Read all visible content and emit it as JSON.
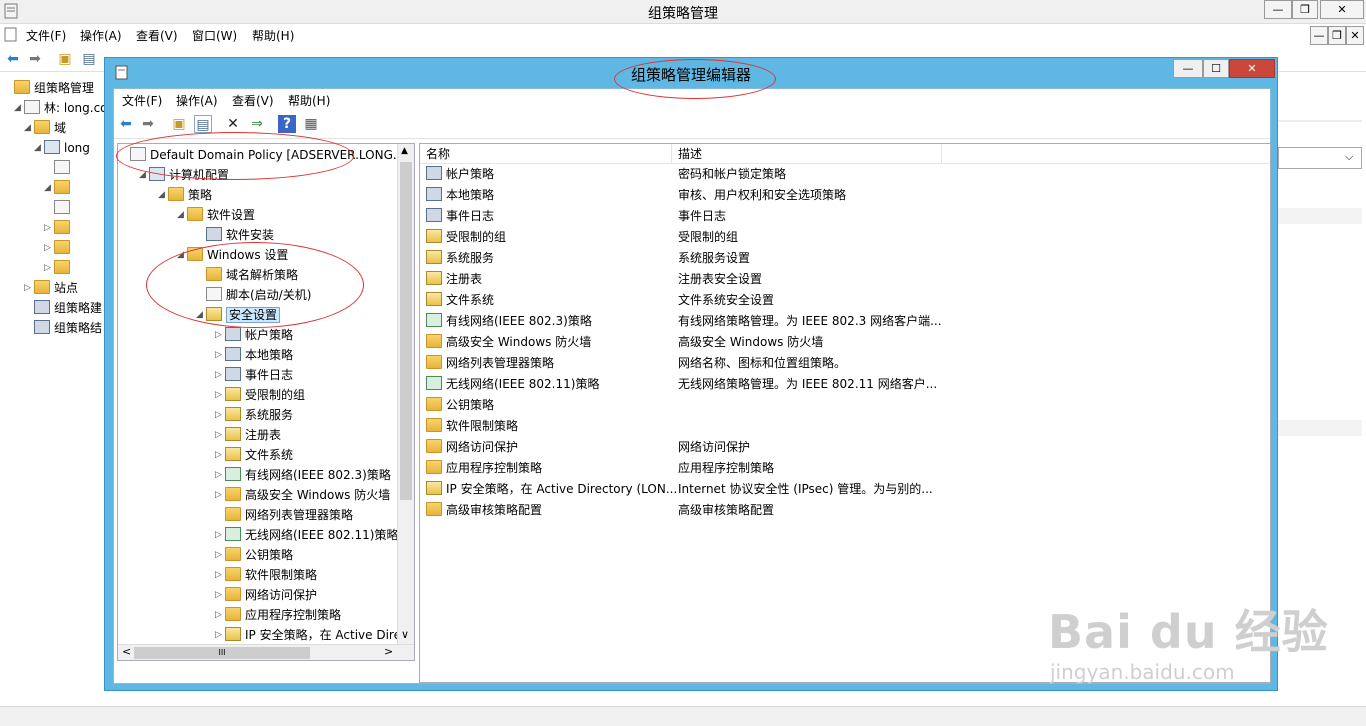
{
  "outer": {
    "title": "组策略管理",
    "win_buttons": {
      "minimize": "—",
      "restore": "❐",
      "close": "✕"
    },
    "menu": [
      "文件(F)",
      "操作(A)",
      "查看(V)",
      "窗口(W)",
      "帮助(H)"
    ],
    "tree": [
      {
        "label": "组策略管理",
        "indent": 0,
        "expander": ""
      },
      {
        "label": "林: long.co",
        "indent": 1,
        "expander": "◢"
      },
      {
        "label": "域",
        "indent": 2,
        "expander": "◢"
      },
      {
        "label": "long",
        "indent": 3,
        "expander": "◢"
      },
      {
        "label": "",
        "indent": 4,
        "expander": ""
      },
      {
        "label": "",
        "indent": 4,
        "expander": "◢"
      },
      {
        "label": "",
        "indent": 4,
        "expander": ""
      },
      {
        "label": "",
        "indent": 4,
        "expander": "▷"
      },
      {
        "label": "",
        "indent": 4,
        "expander": "▷"
      },
      {
        "label": "",
        "indent": 4,
        "expander": "▷"
      },
      {
        "label": "站点",
        "indent": 2,
        "expander": "▷"
      },
      {
        "label": "组策略建",
        "indent": 2,
        "expander": ""
      },
      {
        "label": "组策略结",
        "indent": 2,
        "expander": ""
      }
    ]
  },
  "editor": {
    "title": "组策略管理编辑器",
    "win_buttons": {
      "minimize": "—",
      "maximize": "☐",
      "close": "✕"
    },
    "menu": [
      "文件(F)",
      "操作(A)",
      "查看(V)",
      "帮助(H)"
    ],
    "tree": [
      {
        "label": "Default Domain Policy [ADSERVER.LONG.COI",
        "indent": 0,
        "expander": "",
        "icon": "doc"
      },
      {
        "label": "计算机配置",
        "indent": 1,
        "expander": "◢",
        "icon": "pc"
      },
      {
        "label": "策略",
        "indent": 2,
        "expander": "◢",
        "icon": "folder"
      },
      {
        "label": "软件设置",
        "indent": 3,
        "expander": "◢",
        "icon": "folder"
      },
      {
        "label": "软件安装",
        "indent": 4,
        "expander": "",
        "icon": "book"
      },
      {
        "label": "Windows 设置",
        "indent": 3,
        "expander": "◢",
        "icon": "folder"
      },
      {
        "label": "域名解析策略",
        "indent": 4,
        "expander": "",
        "icon": "folder"
      },
      {
        "label": "脚本(启动/关机)",
        "indent": 4,
        "expander": "",
        "icon": "doc"
      },
      {
        "label": "安全设置",
        "indent": 4,
        "expander": "◢",
        "icon": "shield",
        "selected": true
      },
      {
        "label": "帐户策略",
        "indent": 5,
        "expander": "▷",
        "icon": "book"
      },
      {
        "label": "本地策略",
        "indent": 5,
        "expander": "▷",
        "icon": "book"
      },
      {
        "label": "事件日志",
        "indent": 5,
        "expander": "▷",
        "icon": "book"
      },
      {
        "label": "受限制的组",
        "indent": 5,
        "expander": "▷",
        "icon": "shield"
      },
      {
        "label": "系统服务",
        "indent": 5,
        "expander": "▷",
        "icon": "shield"
      },
      {
        "label": "注册表",
        "indent": 5,
        "expander": "▷",
        "icon": "shield"
      },
      {
        "label": "文件系统",
        "indent": 5,
        "expander": "▷",
        "icon": "shield"
      },
      {
        "label": "有线网络(IEEE 802.3)策略",
        "indent": 5,
        "expander": "▷",
        "icon": "net"
      },
      {
        "label": "高级安全 Windows 防火墙",
        "indent": 5,
        "expander": "▷",
        "icon": "folder"
      },
      {
        "label": "网络列表管理器策略",
        "indent": 5,
        "expander": "",
        "icon": "folder"
      },
      {
        "label": "无线网络(IEEE 802.11)策略",
        "indent": 5,
        "expander": "▷",
        "icon": "net"
      },
      {
        "label": "公钥策略",
        "indent": 5,
        "expander": "▷",
        "icon": "folder"
      },
      {
        "label": "软件限制策略",
        "indent": 5,
        "expander": "▷",
        "icon": "folder"
      },
      {
        "label": "网络访问保护",
        "indent": 5,
        "expander": "▷",
        "icon": "folder"
      },
      {
        "label": "应用程序控制策略",
        "indent": 5,
        "expander": "▷",
        "icon": "folder"
      },
      {
        "label": "IP 安全策略，在 Active Direct",
        "indent": 5,
        "expander": "▷",
        "icon": "shield"
      }
    ],
    "scroll": {
      "up": "▲",
      "down": "∨",
      "left": "<",
      "right": ">",
      "grip": "III"
    },
    "list_columns": [
      "名称",
      "描述"
    ],
    "list_rows": [
      {
        "name": "帐户策略",
        "desc": "密码和帐户锁定策略",
        "icon": "book"
      },
      {
        "name": "本地策略",
        "desc": "审核、用户权利和安全选项策略",
        "icon": "book"
      },
      {
        "name": "事件日志",
        "desc": "事件日志",
        "icon": "book"
      },
      {
        "name": "受限制的组",
        "desc": "受限制的组",
        "icon": "shield"
      },
      {
        "name": "系统服务",
        "desc": "系统服务设置",
        "icon": "shield"
      },
      {
        "name": "注册表",
        "desc": "注册表安全设置",
        "icon": "shield"
      },
      {
        "name": "文件系统",
        "desc": "文件系统安全设置",
        "icon": "shield"
      },
      {
        "name": "有线网络(IEEE 802.3)策略",
        "desc": "有线网络策略管理。为 IEEE 802.3 网络客户端...",
        "icon": "net"
      },
      {
        "name": "高级安全 Windows 防火墙",
        "desc": "高级安全 Windows 防火墙",
        "icon": "folder"
      },
      {
        "name": "网络列表管理器策略",
        "desc": "网络名称、图标和位置组策略。",
        "icon": "folder"
      },
      {
        "name": "无线网络(IEEE 802.11)策略",
        "desc": "无线网络策略管理。为 IEEE 802.11 网络客户...",
        "icon": "net"
      },
      {
        "name": "公钥策略",
        "desc": "",
        "icon": "folder"
      },
      {
        "name": "软件限制策略",
        "desc": "",
        "icon": "folder"
      },
      {
        "name": "网络访问保护",
        "desc": "网络访问保护",
        "icon": "folder"
      },
      {
        "name": "应用程序控制策略",
        "desc": "应用程序控制策略",
        "icon": "folder"
      },
      {
        "name": "IP 安全策略，在 Active Directory (LON...",
        "desc": "Internet 协议安全性 (IPsec) 管理。为与别的...",
        "icon": "shield"
      },
      {
        "name": "高级审核策略配置",
        "desc": "高级审核策略配置",
        "icon": "folder"
      }
    ]
  },
  "watermark": {
    "logo": "Bai du 经验",
    "url": "jingyan.baidu.com"
  },
  "colors": {
    "editor_frame": "#5fb8e3",
    "annotation": "#dd3333",
    "selection": "#cce8ff"
  }
}
